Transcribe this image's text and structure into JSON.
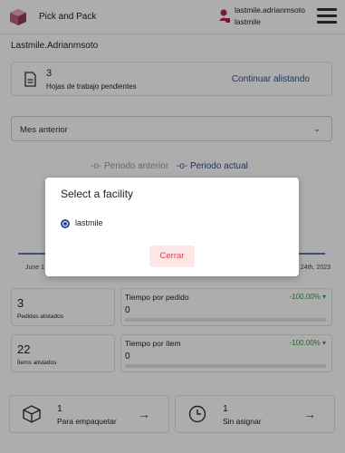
{
  "header": {
    "app_name": "Pick and Pack",
    "user_name": "lastmile.adrianmsoto",
    "user_org": "lastmile",
    "logo_icon": "box-logo-icon",
    "user_icon": "user-icon",
    "menu_icon": "hamburger-menu-icon"
  },
  "user_label": "Lastmile.Adrianmsoto",
  "worksheets": {
    "count": "3",
    "label": "Hojas de trabajo pendientes",
    "link": "Continuar alistando",
    "icon": "document-icon"
  },
  "period_select": {
    "value": "Mes anterior",
    "icon": "chevron-down-icon"
  },
  "chart_data": {
    "type": "line",
    "legend": [
      "Periodo anterior",
      "Periodo actual"
    ],
    "x_tick_labels": [
      "June 1",
      "y 24th, 2023"
    ],
    "series": [
      {
        "name": "Periodo anterior",
        "color": "#aaaaaa",
        "values": [
          0,
          0
        ]
      },
      {
        "name": "Periodo actual",
        "color": "#2c4a9a",
        "values": [
          0,
          0
        ]
      }
    ]
  },
  "kpis": [
    {
      "count": "3",
      "count_label": "Pedidos alistados",
      "metric_title": "Tiempo por pedido",
      "metric_value": "0",
      "change": "-100.00% ▾",
      "progress_fraction": 0
    },
    {
      "count": "22",
      "count_label": "Ítems alistados",
      "metric_title": "Tiempo por ítem",
      "metric_value": "0",
      "change": "-100.00% ▾",
      "progress_fraction": 0
    }
  ],
  "bottom_cards": [
    {
      "count": "1",
      "label": "Para empaquetar",
      "icon": "package-icon",
      "arrow": "→"
    },
    {
      "count": "1",
      "label": "Sin asignar",
      "icon": "clock-icon",
      "arrow": "→"
    }
  ],
  "dialog": {
    "title": "Select a facility",
    "option": "lastmile",
    "close_label": "Cerrar"
  },
  "colors": {
    "accent": "#2c4a9a",
    "positive": "#2e9a4a",
    "danger": "#d64545",
    "danger_bg": "#fce6e6"
  }
}
